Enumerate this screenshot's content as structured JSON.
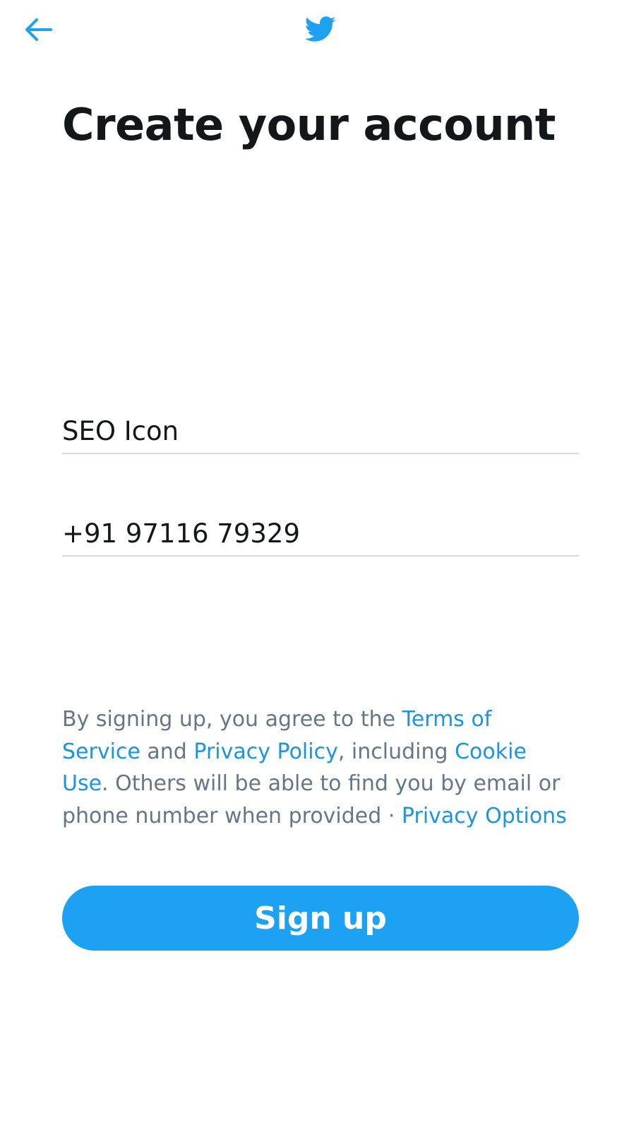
{
  "header": {
    "back_icon": "back-arrow-icon",
    "logo_icon": "twitter-bird-icon",
    "accent_color": "#1da1f2"
  },
  "main": {
    "title": "Create your account",
    "name_field": {
      "value": "SEO Icon"
    },
    "phone_field": {
      "value": "+91 97116 79329"
    },
    "legal": {
      "text_1": "By signing up, you agree to the ",
      "terms_link": "Terms of Service",
      "text_2": " and ",
      "privacy_link": "Privacy Policy",
      "text_3": ", including ",
      "cookie_link": "Cookie Use",
      "text_4": ". Others will be able to find you by email or phone number when provided · ",
      "privacy_options_link": "Privacy Options"
    },
    "signup_label": "Sign up"
  }
}
